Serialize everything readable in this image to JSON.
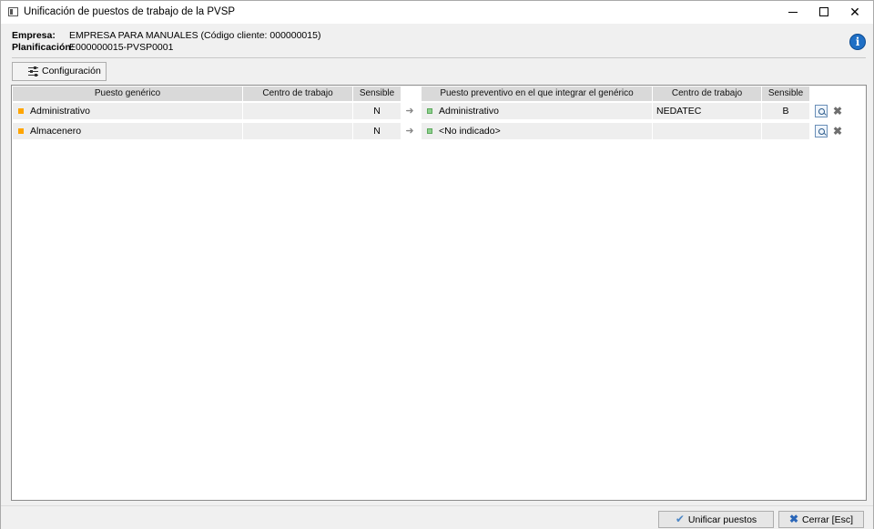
{
  "window": {
    "title": "Unificación de puestos de trabajo de la PVSP"
  },
  "info": {
    "empresa_label": "Empresa:",
    "empresa_value": "EMPRESA PARA MANUALES (Código cliente: 000000015)",
    "planificacion_label": "Planificación:",
    "planificacion_value": "E000000015-PVSP0001"
  },
  "toolbar": {
    "config_label": "Configuración"
  },
  "grid": {
    "columns": {
      "puesto_generico": "Puesto genérico",
      "centro_trabajo_1": "Centro de trabajo",
      "sensible_1": "Sensible",
      "puesto_preventivo": "Puesto preventivo en el que integrar el genérico",
      "centro_trabajo_2": "Centro de trabajo",
      "sensible_2": "Sensible"
    },
    "rows": [
      {
        "puesto": "Administrativo",
        "centro": "",
        "sensible": "N",
        "puesto_prev": "Administrativo",
        "centro_prev": "NEDATEC",
        "sensible_prev": "B"
      },
      {
        "puesto": "Almacenero",
        "centro": "",
        "sensible": "N",
        "puesto_prev": "<No indicado>",
        "centro_prev": "",
        "sensible_prev": ""
      }
    ]
  },
  "buttons": {
    "unify_label": "Unificar puestos",
    "close_label": "Cerrar  [Esc]"
  },
  "colors": {
    "generic_marker": "#ffa500",
    "preventive_marker": "#8ed08e",
    "info_icon": "#1f6fc5"
  }
}
